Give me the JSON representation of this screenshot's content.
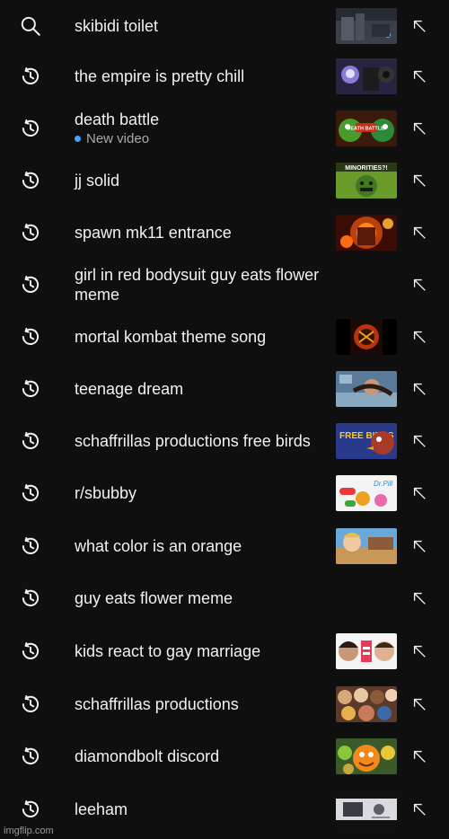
{
  "history": [
    {
      "query": "skibidi toilet",
      "icon": "search-icon",
      "thumbnail": "skibidi-toilet-thumbnail"
    },
    {
      "query": "the empire is pretty chill",
      "icon": "history-icon",
      "thumbnail": "empire-thumbnail"
    },
    {
      "query": "death battle",
      "sub": "New video",
      "icon": "history-icon",
      "thumbnail": "death-battle-thumbnail",
      "thumb_text": "DEATH BATTLE!"
    },
    {
      "query": "jj solid",
      "icon": "history-icon",
      "thumbnail": "hulk-thumbnail",
      "thumb_text": "MINORITIES?!"
    },
    {
      "query": "spawn mk11 entrance",
      "icon": "history-icon",
      "thumbnail": "spawn-thumbnail"
    },
    {
      "query": "girl in red bodysuit guy eats flower meme",
      "icon": "history-icon",
      "thumbnail": null
    },
    {
      "query": "mortal kombat theme song",
      "icon": "history-icon",
      "thumbnail": "mortal-kombat-thumbnail"
    },
    {
      "query": "teenage dream",
      "icon": "history-icon",
      "thumbnail": "teenage-dream-thumbnail"
    },
    {
      "query": "schaffrillas productions free birds",
      "icon": "history-icon",
      "thumbnail": "free-birds-thumbnail",
      "thumb_text": "FREE BIRDS"
    },
    {
      "query": "r/sbubby",
      "icon": "history-icon",
      "thumbnail": "pills-thumbnail",
      "thumb_text": "Dr.Pill"
    },
    {
      "query": "what color is an orange",
      "icon": "history-icon",
      "thumbnail": "orange-thumbnail"
    },
    {
      "query": "guy eats flower meme",
      "icon": "history-icon",
      "thumbnail": null
    },
    {
      "query": "kids react to gay marriage",
      "icon": "history-icon",
      "thumbnail": "kids-react-thumbnail"
    },
    {
      "query": "schaffrillas productions",
      "icon": "history-icon",
      "thumbnail": "schaffrillas-thumbnail"
    },
    {
      "query": "diamondbolt discord",
      "icon": "history-icon",
      "thumbnail": "annoying-orange-thumbnail"
    },
    {
      "query": "leeham",
      "icon": "history-icon",
      "thumbnail": "leeham-thumbnail"
    }
  ],
  "watermark": "imgflip.com",
  "colors": {
    "background": "#0f0f0f",
    "text": "#f1f1f1",
    "subtext": "#aaaaaa",
    "dot": "#3ea6ff",
    "icon": "#f1f1f1"
  }
}
